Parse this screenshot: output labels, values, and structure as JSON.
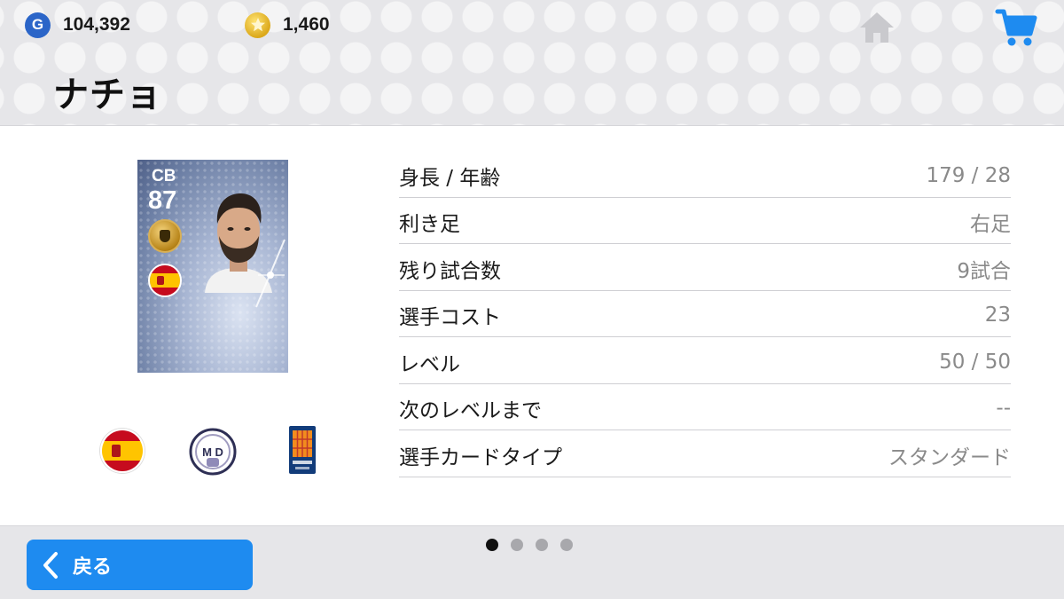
{
  "header": {
    "gp_amount": "104,392",
    "coins_amount": "1,460",
    "gp_icon_letter": "G",
    "title": "ナチョ"
  },
  "icons": {
    "gp": "g-coin-icon",
    "coins": "star-coin-icon",
    "home": "home-icon",
    "cart": "shopping-cart-icon",
    "back": "chevron-left-icon"
  },
  "card": {
    "position": "CB",
    "rating": "87",
    "nationality_flag": "spain-flag"
  },
  "stats": [
    {
      "label": "身長 / 年齢",
      "value": "179 / 28"
    },
    {
      "label": "利き足",
      "value": "右足"
    },
    {
      "label": "残り試合数",
      "value": "9試合"
    },
    {
      "label": "選手コスト",
      "value": "23"
    },
    {
      "label": "レベル",
      "value": "50 / 50"
    },
    {
      "label": "次のレベルまで",
      "value": "--"
    },
    {
      "label": "選手カードタイプ",
      "value": "スタンダード"
    }
  ],
  "footer": {
    "back_label": "戻る",
    "page_count": 4,
    "active_page": 1
  },
  "colors": {
    "accent": "#1e8bf0",
    "gp": "#2b65c8",
    "coin": "#dba81a"
  }
}
